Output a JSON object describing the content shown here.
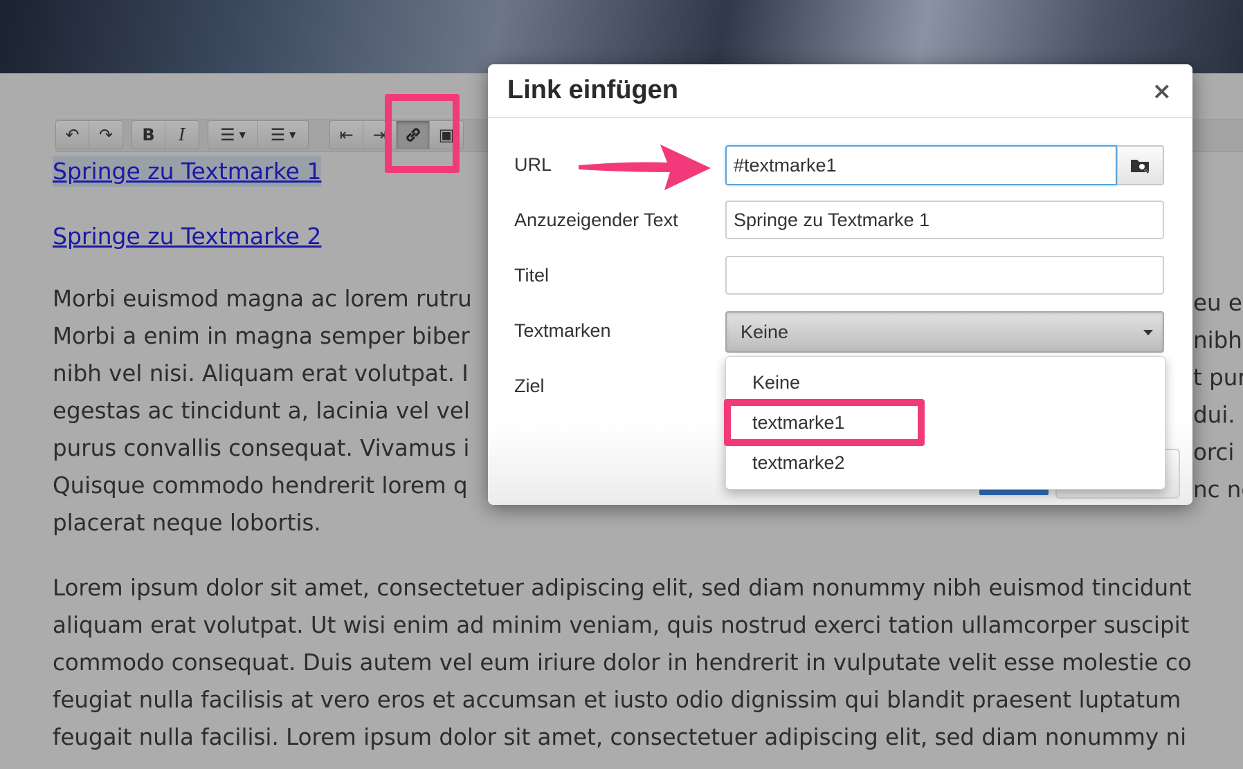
{
  "toolbar": {
    "items": [
      {
        "name": "undo-icon",
        "glyph": "↶"
      },
      {
        "name": "redo-icon",
        "glyph": "↷"
      },
      {
        "name": "bold-icon",
        "glyph": "B"
      },
      {
        "name": "italic-icon",
        "glyph": "I"
      },
      {
        "name": "bullet-list-icon",
        "glyph": "☰"
      },
      {
        "name": "numbered-list-icon",
        "glyph": "☰"
      },
      {
        "name": "outdent-icon",
        "glyph": "⇤"
      },
      {
        "name": "indent-icon",
        "glyph": "⇥"
      },
      {
        "name": "link-icon",
        "glyph": "🔗"
      },
      {
        "name": "image-icon",
        "glyph": "▣"
      }
    ]
  },
  "content": {
    "links": [
      "Springe zu Textmarke 1",
      "Springe zu Textmarke 2"
    ],
    "paragraph1": [
      "Morbi euismod magna ac lorem rutru",
      "Morbi a enim in magna semper biber",
      "nibh vel nisi. Aliquam erat volutpat. I",
      "egestas ac tincidunt a, lacinia vel vel",
      "purus convallis consequat. Vivamus i",
      "Quisque commodo hendrerit lorem q",
      "placerat neque lobortis."
    ],
    "paragraph1_right": [
      "eu e",
      "nibh",
      "t pur",
      "dui.",
      "orci i",
      "nc ne",
      ""
    ],
    "paragraph2": [
      "Lorem ipsum dolor sit amet, consectetuer adipiscing elit, sed diam nonummy nibh euismod tincidunt",
      "aliquam erat volutpat. Ut wisi enim ad minim veniam, quis nostrud exerci tation ullamcorper suscipit",
      "commodo consequat. Duis autem vel eum iriure dolor in hendrerit in vulputate velit esse molestie co",
      "feugiat nulla facilisis at vero eros et accumsan et iusto odio dignissim qui blandit praesent luptatum",
      "feugait nulla facilisi. Lorem ipsum dolor sit amet, consectetuer adipiscing elit, sed diam nonummy ni"
    ]
  },
  "dialog": {
    "title": "Link einfügen",
    "close": "×",
    "url_label": "URL",
    "url_value": "#textmarke1",
    "text_label": "Anzuzeigender Text",
    "text_value": "Springe zu Textmarke 1",
    "title_label": "Titel",
    "title_value": "",
    "bookmarks_label": "Textmarken",
    "bookmarks_selected": "Keine",
    "target_label": "Ziel",
    "bookmark_options": [
      "Keine",
      "textmarke1",
      "textmarke2"
    ]
  },
  "colors": {
    "highlight": "#f23a7a",
    "link": "#1a1aa5",
    "focus": "#5da2d8"
  }
}
